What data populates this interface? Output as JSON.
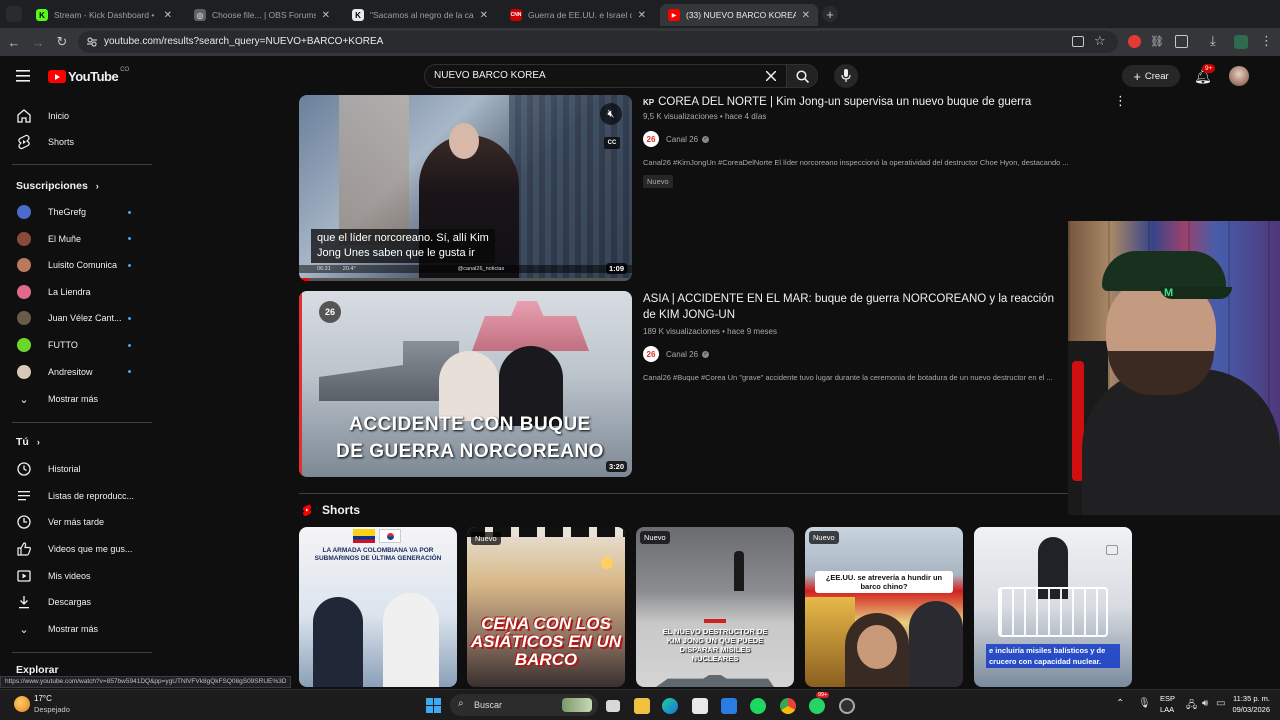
{
  "browser": {
    "tabs": [
      {
        "title": "Stream - Kick Dashboard •",
        "favicon_color": "#53fc18",
        "favicon_glyph": "K"
      },
      {
        "title": "Choose file... | OBS Forums",
        "favicon_color": "#5f6368",
        "favicon_glyph": "◎"
      },
      {
        "title": "\"Sacamos al negro de la cabez...",
        "favicon_color": "#e8eaed",
        "favicon_glyph": "K"
      },
      {
        "title": "Guerra de EE.UU. e Israel con Ir...",
        "favicon_color": "#cc0000",
        "favicon_glyph": "CNN"
      },
      {
        "title": "(33) NUEVO BARCO KOREA - Yo...",
        "favicon_color": "#ff0000",
        "favicon_glyph": "▶"
      }
    ],
    "url": "youtube.com/results?search_query=NUEVO+BARCO+KOREA",
    "status_url": "https://www.youtube.com/watch?v=857bw5941DQ&pp=ygUTNlVFVk8gQkFSQ08gS09SRUE%3D"
  },
  "youtube": {
    "logo_text": "YouTube",
    "logo_country": "CO",
    "search_query": "NUEVO BARCO KOREA",
    "create_label": "Crear",
    "notification_count": "9+"
  },
  "sidebar": {
    "main": [
      {
        "label": "Inicio",
        "icon": "home-icon"
      },
      {
        "label": "Shorts",
        "icon": "shorts-icon"
      }
    ],
    "subscriptions_header": "Suscripciones",
    "subscriptions": [
      {
        "label": "TheGrefg",
        "color": "#4a6cc9",
        "dot": true
      },
      {
        "label": "El Muñe",
        "color": "#8a4a3a",
        "dot": true
      },
      {
        "label": "Luisito Comunica",
        "color": "#b87a5a",
        "dot": true
      },
      {
        "label": "La Liendra",
        "color": "#e06a8a",
        "dot": false
      },
      {
        "label": "Juan Vélez Cant...",
        "color": "#6a5a4a",
        "dot": true
      },
      {
        "label": "FUTTO",
        "color": "#6ad82a",
        "dot": true
      },
      {
        "label": "Andresitow",
        "color": "#d8c8b8",
        "dot": true
      }
    ],
    "show_more": "Mostrar más",
    "you_header": "Tú",
    "you_items": [
      {
        "label": "Historial",
        "icon": "history-icon"
      },
      {
        "label": "Listas de reproducc...",
        "icon": "playlists-icon"
      },
      {
        "label": "Ver más tarde",
        "icon": "watch-later-icon"
      },
      {
        "label": "Videos que me gus...",
        "icon": "like-icon"
      },
      {
        "label": "Mis videos",
        "icon": "my-videos-icon"
      },
      {
        "label": "Descargas",
        "icon": "download-icon"
      }
    ],
    "show_more_2": "Mostrar más",
    "explore_header": "Explorar"
  },
  "results": [
    {
      "flag": "KP",
      "title": "COREA DEL NORTE | Kim Jong-un supervisa un nuevo buque de guerra",
      "meta": "9,5 K visualizaciones • hace 4 días",
      "channel": "Canal 26",
      "channel_badge": "26",
      "description": "Canal26 #KimJongUn #CoreaDelNorte El líder norcoreano inspeccionó la operatividad del destructor Choe Hyon, destacando ...",
      "badge": "Nuevo",
      "duration": "1:09",
      "caption_line1": "que el líder norcoreano. Sí, allí Kim",
      "caption_line2": "Jong Unes saben que le gusta ir",
      "overlay_time": "06:31",
      "overlay_temp": "20.4°",
      "overlay_handle": "@canal26_noticias"
    },
    {
      "flag": "",
      "title": "ASIA | ACCIDENTE EN EL MAR: buque de guerra NORCOREANO y la reacción de KIM JONG-UN",
      "meta": "189 K visualizaciones • hace 9 meses",
      "channel": "Canal 26",
      "channel_badge": "26",
      "description": "Canal26 #Buque #Corea Un \"grave\" accidente tuvo lugar durante la ceremonia de botadura de un nuevo destructor en el ...",
      "duration": "3:20",
      "thumb_line1": "ACCIDENTE CON BUQUE",
      "thumb_line2": "DE GUERRA NORCOREANO"
    }
  ],
  "shorts": {
    "header": "Shorts",
    "items": [
      {
        "text": "LA ARMADA COLOMBIANA VA POR SUBMARINOS DE ÚLTIMA GENERACIÓN",
        "nuevo": false
      },
      {
        "text": "CENA CON LOS ASIÁTICOS EN UN BARCO",
        "nuevo": true
      },
      {
        "text": "EL NUEVO DESTRUCTOR DE KIM JONG UN QUE PUEDE DISPARAR MISILES NUCLEARES",
        "nuevo": true
      },
      {
        "text": "¿EE.UU. se atrevería a hundir un barco chino?",
        "nuevo": true
      },
      {
        "text": "e incluiría misiles balísticos y de crucero con capacidad nuclear.",
        "nuevo": false
      }
    ],
    "nuevo_label": "Nuevo"
  },
  "taskbar": {
    "weather_temp": "17°C",
    "weather_desc": "Despejado",
    "search_label": "Buscar",
    "lang_top": "ESP",
    "lang_bottom": "LAA",
    "time": "11:35 p. m.",
    "date": "09/03/2026",
    "badge_count": "99+"
  }
}
